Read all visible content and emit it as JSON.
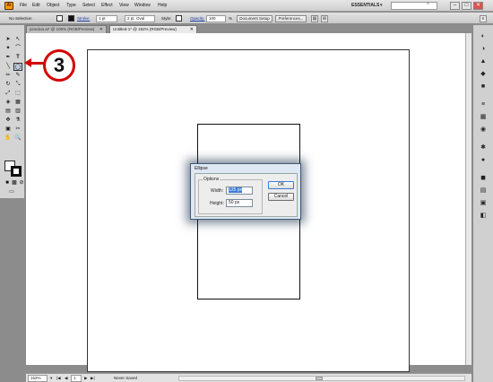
{
  "app": {
    "icon_label": "Ai"
  },
  "menu": {
    "items": [
      "File",
      "Edit",
      "Object",
      "Type",
      "Select",
      "Effect",
      "View",
      "Window",
      "Help"
    ]
  },
  "workspace": {
    "label": "ESSENTIALS",
    "caret": "▾"
  },
  "window_controls": {
    "minimize": "–",
    "maximize": "□",
    "close": "✕"
  },
  "control_bar": {
    "selection_label": "No Selection",
    "stroke_label": "Stroke:",
    "stroke_value": "1 pt",
    "brush_value": "2 pt. Oval",
    "style_label": "Style:",
    "opacity_label": "Opacity:",
    "opacity_value": "100",
    "opacity_unit": "%",
    "document_setup_label": "Document Setup",
    "preferences_label": "Preferences..."
  },
  "tabs": [
    {
      "label": "pinedoa.ai* @ 100% (RGB/Preview)",
      "close": "✕"
    },
    {
      "label": "Untitled-1* @ 152% (RGB/Preview)",
      "close": "✕"
    }
  ],
  "tools": [
    "➤",
    "↖",
    "✦",
    "⌒",
    "✒",
    "T",
    "╲",
    "◯",
    "✏",
    "✎",
    "↻",
    "⤡",
    "⤢",
    "⬚",
    "◈",
    "▦",
    "▤",
    "▥",
    "✥",
    "⚗",
    "▣",
    "✂",
    "✋",
    "🔍"
  ],
  "right_panel_icons": [
    "◐",
    "◑",
    "▲",
    "◆",
    "■",
    "≡",
    "▦",
    "◉",
    "✱",
    "●",
    "◼",
    "▤",
    "▣",
    "◧"
  ],
  "status_bar": {
    "zoom_value": "152%",
    "page_value": "1",
    "status_text": "Never Saved"
  },
  "dialog": {
    "title": "Ellipse",
    "group_label": "Options",
    "width_label": "Width:",
    "width_value": "125 px",
    "height_label": "Height:",
    "height_value": "50 px",
    "ok_label": "OK",
    "cancel_label": "Cancel"
  },
  "annotation": {
    "step_number": "3"
  }
}
